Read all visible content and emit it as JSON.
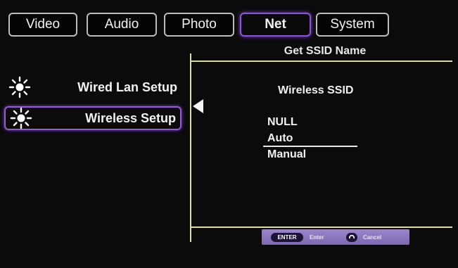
{
  "tabs": [
    {
      "label": "Video",
      "active": false
    },
    {
      "label": "Audio",
      "active": false
    },
    {
      "label": "Photo",
      "active": false
    },
    {
      "label": "Net",
      "active": true
    },
    {
      "label": "System",
      "active": false
    }
  ],
  "sidebar": {
    "items": [
      {
        "label": "Wired Lan Setup",
        "icon": "sun-icon",
        "selected": false
      },
      {
        "label": "Wireless Setup",
        "icon": "sun-icon",
        "selected": true
      }
    ]
  },
  "panel": {
    "title": "Get SSID Name",
    "subtitle": "Wireless SSID",
    "options": [
      {
        "label": "NULL",
        "highlighted": false
      },
      {
        "label": "Auto",
        "highlighted": true
      },
      {
        "label": "Manual",
        "highlighted": false
      }
    ]
  },
  "footer": {
    "enter_key": "ENTER",
    "enter_label": "Enter",
    "cancel_icon": "back-icon",
    "cancel_label": "Cancel"
  },
  "colors": {
    "active_border": "#8f55d8",
    "panel_line": "#dcdca8",
    "hint_bar": "#8a76bc"
  }
}
